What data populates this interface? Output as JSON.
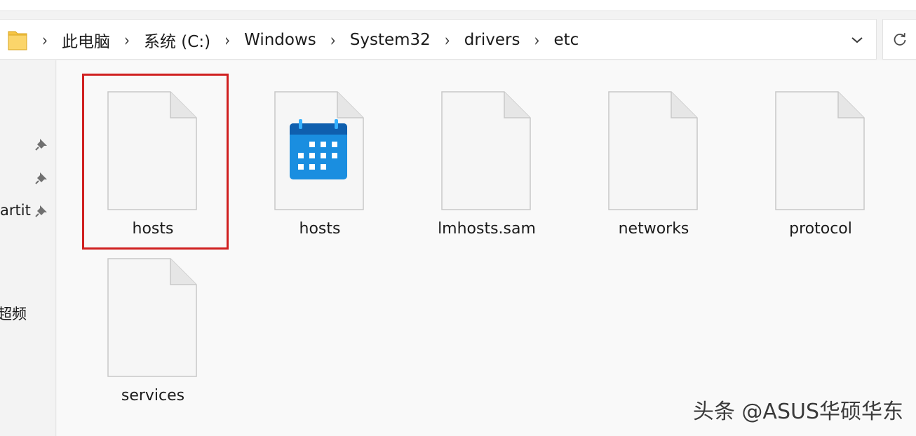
{
  "breadcrumb": {
    "folder_icon": "folder-icon",
    "separator": "›",
    "items": [
      "此电脑",
      "系统 (C:)",
      "Windows",
      "System32",
      "drivers",
      "etc"
    ]
  },
  "toolbar": {
    "dropdown_icon": "chevron-down-icon",
    "refresh_icon": "refresh-icon"
  },
  "nav": {
    "pin_icon": "pin-icon",
    "partial_labels": [
      "artit",
      "超频"
    ]
  },
  "files": [
    {
      "name": "hosts",
      "icon": "blank-file-icon",
      "selected": true
    },
    {
      "name": "hosts",
      "icon": "calendar-file-icon",
      "selected": false
    },
    {
      "name": "lmhosts.sam",
      "icon": "blank-file-icon",
      "selected": false
    },
    {
      "name": "networks",
      "icon": "blank-file-icon",
      "selected": false
    },
    {
      "name": "protocol",
      "icon": "blank-file-icon",
      "selected": false
    },
    {
      "name": "services",
      "icon": "blank-file-icon",
      "selected": false
    }
  ],
  "colors": {
    "highlight_border": "#d02020",
    "calendar_blue": "#1a7fd8",
    "folder_yellow": "#f6c543"
  },
  "watermark": "头条 @ASUS华硕华东"
}
